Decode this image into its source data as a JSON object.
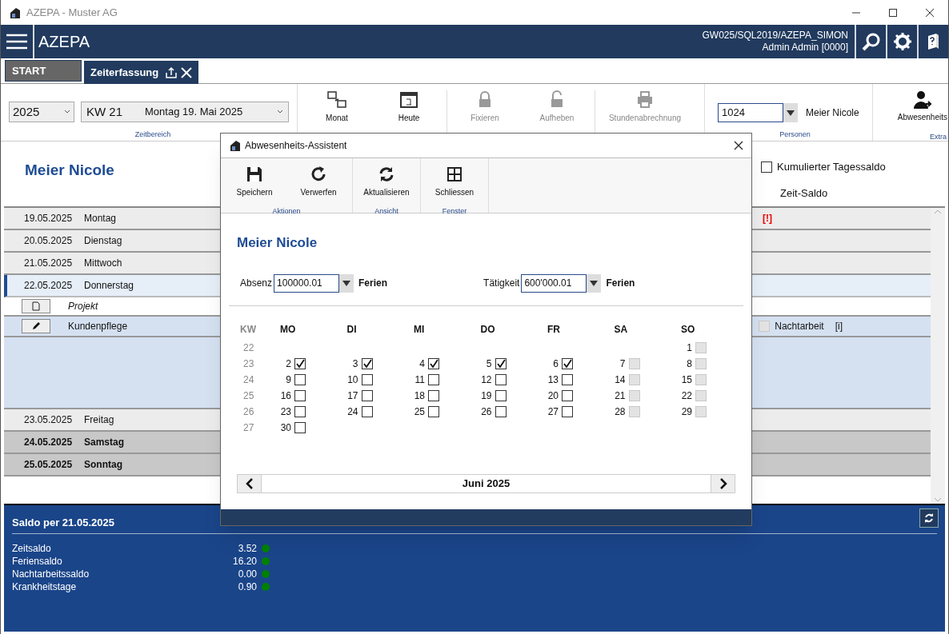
{
  "window": {
    "title": "AZEPA - Muster AG"
  },
  "header": {
    "app": "AZEPA",
    "server": "GW025/SQL2019/AZEPA_SIMON",
    "user": "Admin Admin [0000]"
  },
  "tabs": [
    {
      "label": "START",
      "selected": false,
      "closable": false
    },
    {
      "label": "Zeiterfassung",
      "selected": true,
      "closable": true
    }
  ],
  "toolbar": {
    "year": "2025",
    "week": "KW 21",
    "date": "Montag 19. Mai 2025",
    "zeitbereich_label": "Zeitbereich",
    "buttons": [
      {
        "label": "Monat",
        "kind": "month",
        "disabled": false
      },
      {
        "label": "Heute",
        "kind": "today",
        "disabled": false
      },
      {
        "label": "Fixieren",
        "kind": "lock",
        "disabled": true
      },
      {
        "label": "Aufheben",
        "kind": "unlock",
        "disabled": true
      },
      {
        "label": "Stundenabrechnung",
        "kind": "print",
        "disabled": true
      }
    ],
    "person_id": "1024",
    "person_name": "Meier Nicole",
    "personen_label": "Personen",
    "extra_button": "Abwesenheits",
    "extra_label": "Extra"
  },
  "person_heading": "Meier Nicole",
  "cumulative": {
    "label": "Kumulierter Tagessaldo",
    "checked": false
  },
  "zeit_saldo_label": "Zeit-Saldo",
  "days": [
    {
      "date": "19.05.2025",
      "day": "Montag",
      "kind": "weekday",
      "selected": false,
      "flag": "[!]"
    },
    {
      "date": "20.05.2025",
      "day": "Dienstag",
      "kind": "weekday",
      "selected": false
    },
    {
      "date": "21.05.2025",
      "day": "Mittwoch",
      "kind": "weekday",
      "selected": false
    },
    {
      "date": "22.05.2025",
      "day": "Donnerstag",
      "kind": "weekday",
      "selected": true,
      "detail": {
        "project_label": "Projekt",
        "activity": "Kundenpflege",
        "night_work": {
          "label": "Nachtarbeit",
          "checked": false
        },
        "info": "[i]"
      }
    },
    {
      "date": "23.05.2025",
      "day": "Freitag",
      "kind": "weekday",
      "selected": false
    },
    {
      "date": "24.05.2025",
      "day": "Samstag",
      "kind": "weekend",
      "selected": false
    },
    {
      "date": "25.05.2025",
      "day": "Sonntag",
      "kind": "weekend",
      "selected": false
    }
  ],
  "saldo": {
    "title": "Saldo per 21.05.2025",
    "rows": [
      {
        "label": "Zeitsaldo",
        "value": "3.52",
        "color": "#008000"
      },
      {
        "label": "Feriensaldo",
        "value": "16.20",
        "color": "#008000"
      },
      {
        "label": "Nachtarbeitssaldo",
        "value": "0.00",
        "color": "#008000"
      },
      {
        "label": "Krankheitstage",
        "value": "0.90",
        "color": "#008000"
      }
    ]
  },
  "dialog": {
    "title": "Abwesenheits-Assistent",
    "groups": [
      {
        "label": "Aktionen",
        "buttons": [
          {
            "label": "Speichern",
            "kind": "save"
          },
          {
            "label": "Verwerfen",
            "kind": "redo"
          }
        ]
      },
      {
        "label": "Ansicht",
        "buttons": [
          {
            "label": "Aktualisieren",
            "kind": "refresh"
          }
        ]
      },
      {
        "label": "Fenster",
        "buttons": [
          {
            "label": "Schliessen",
            "kind": "grid"
          }
        ]
      }
    ],
    "person": "Meier Nicole",
    "absence": {
      "label": "Absenz",
      "value": "100000.01",
      "name": "Ferien"
    },
    "activity": {
      "label": "Tätigkeit",
      "value": "600'000.01",
      "name": "Ferien"
    },
    "kw_header": "KW",
    "weekdays": [
      "MO",
      "DI",
      "MI",
      "DO",
      "FR",
      "SA",
      "SO"
    ],
    "weeks": [
      {
        "kw": "22",
        "days": [
          {
            "day": "1",
            "checked": false,
            "disabled": true
          }
        ]
      },
      {
        "kw": "23",
        "days": [
          {
            "day": "2",
            "checked": true,
            "disabled": false
          },
          {
            "day": "3",
            "checked": true,
            "disabled": false
          },
          {
            "day": "4",
            "checked": true,
            "disabled": false
          },
          {
            "day": "5",
            "checked": true,
            "disabled": false
          },
          {
            "day": "6",
            "checked": true,
            "disabled": false
          },
          {
            "day": "7",
            "checked": false,
            "disabled": true
          },
          {
            "day": "8",
            "checked": false,
            "disabled": true
          }
        ]
      },
      {
        "kw": "24",
        "days": [
          {
            "day": "9",
            "checked": false,
            "disabled": false
          },
          {
            "day": "10",
            "checked": false,
            "disabled": false
          },
          {
            "day": "11",
            "checked": false,
            "disabled": false
          },
          {
            "day": "12",
            "checked": false,
            "disabled": false
          },
          {
            "day": "13",
            "checked": false,
            "disabled": false
          },
          {
            "day": "14",
            "checked": false,
            "disabled": true
          },
          {
            "day": "15",
            "checked": false,
            "disabled": true
          }
        ]
      },
      {
        "kw": "25",
        "days": [
          {
            "day": "16",
            "checked": false,
            "disabled": false
          },
          {
            "day": "17",
            "checked": false,
            "disabled": false
          },
          {
            "day": "18",
            "checked": false,
            "disabled": false
          },
          {
            "day": "19",
            "checked": false,
            "disabled": false
          },
          {
            "day": "20",
            "checked": false,
            "disabled": false
          },
          {
            "day": "21",
            "checked": false,
            "disabled": true
          },
          {
            "day": "22",
            "checked": false,
            "disabled": true
          }
        ]
      },
      {
        "kw": "26",
        "days": [
          {
            "day": "23",
            "checked": false,
            "disabled": false
          },
          {
            "day": "24",
            "checked": false,
            "disabled": false
          },
          {
            "day": "25",
            "checked": false,
            "disabled": false
          },
          {
            "day": "26",
            "checked": false,
            "disabled": false
          },
          {
            "day": "27",
            "checked": false,
            "disabled": false
          },
          {
            "day": "28",
            "checked": false,
            "disabled": true
          },
          {
            "day": "29",
            "checked": false,
            "disabled": true
          }
        ]
      },
      {
        "kw": "27",
        "days": [
          {
            "day": "30",
            "checked": false,
            "disabled": false
          }
        ]
      }
    ],
    "month": "Juni 2025"
  }
}
